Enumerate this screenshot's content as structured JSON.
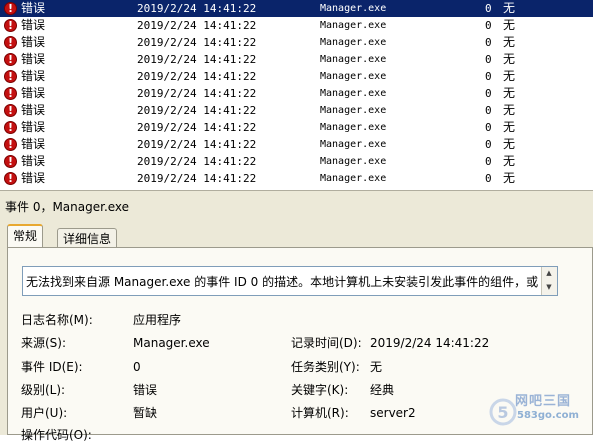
{
  "event_list": {
    "rows": [
      {
        "level": "错误",
        "datetime": "2019/2/24 14:41:22",
        "source": "Manager.exe",
        "category": "0",
        "event_id": "无",
        "selected": true
      },
      {
        "level": "错误",
        "datetime": "2019/2/24 14:41:22",
        "source": "Manager.exe",
        "category": "0",
        "event_id": "无"
      },
      {
        "level": "错误",
        "datetime": "2019/2/24 14:41:22",
        "source": "Manager.exe",
        "category": "0",
        "event_id": "无"
      },
      {
        "level": "错误",
        "datetime": "2019/2/24 14:41:22",
        "source": "Manager.exe",
        "category": "0",
        "event_id": "无"
      },
      {
        "level": "错误",
        "datetime": "2019/2/24 14:41:22",
        "source": "Manager.exe",
        "category": "0",
        "event_id": "无"
      },
      {
        "level": "错误",
        "datetime": "2019/2/24 14:41:22",
        "source": "Manager.exe",
        "category": "0",
        "event_id": "无"
      },
      {
        "level": "错误",
        "datetime": "2019/2/24 14:41:22",
        "source": "Manager.exe",
        "category": "0",
        "event_id": "无"
      },
      {
        "level": "错误",
        "datetime": "2019/2/24 14:41:22",
        "source": "Manager.exe",
        "category": "0",
        "event_id": "无"
      },
      {
        "level": "错误",
        "datetime": "2019/2/24 14:41:22",
        "source": "Manager.exe",
        "category": "0",
        "event_id": "无"
      },
      {
        "level": "错误",
        "datetime": "2019/2/24 14:41:22",
        "source": "Manager.exe",
        "category": "0",
        "event_id": "无"
      },
      {
        "level": "错误",
        "datetime": "2019/2/24 14:41:22",
        "source": "Manager.exe",
        "category": "0",
        "event_id": "无"
      }
    ],
    "icon": "error-icon",
    "selection_color": "#0a246a"
  },
  "detail": {
    "title": "事件 0，Manager.exe",
    "tabs": [
      "常规",
      "详细信息"
    ],
    "description": "无法找到来自源 Manager.exe 的事件 ID 0 的描述。本地计算机上未安装引发此事件的组件，或",
    "fields": {
      "log_name_label": "日志名称(M):",
      "log_name": "应用程序",
      "source_label": "来源(S):",
      "source": "Manager.exe",
      "logged_label": "记录时间(D):",
      "logged": "2019/2/24 14:41:22",
      "event_id_label": "事件 ID(E):",
      "event_id": "0",
      "task_category_label": "任务类别(Y):",
      "task_category": "无",
      "level_label": "级别(L):",
      "level": "错误",
      "keywords_label": "关键字(K):",
      "keywords": "经典",
      "user_label": "用户(U):",
      "user": "暂缺",
      "computer_label": "计算机(R):",
      "computer": "server2",
      "opcode_label": "操作代码(O):"
    }
  },
  "watermark": {
    "line1": "网吧三国",
    "line2": "583go.com"
  }
}
